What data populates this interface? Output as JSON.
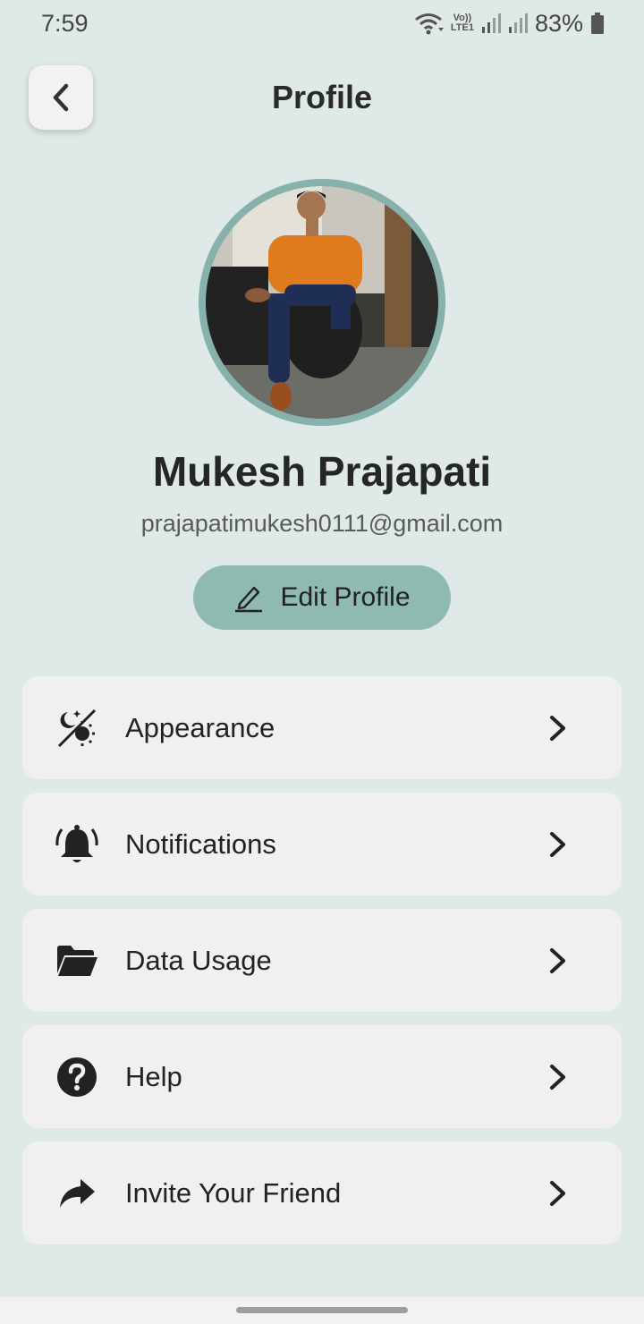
{
  "status_bar": {
    "time": "7:59",
    "volte_top": "Vo))",
    "volte_bottom": "LTE1",
    "battery": "83%"
  },
  "header": {
    "title": "Profile",
    "back_icon": "chevron-left-icon"
  },
  "profile": {
    "name": "Mukesh Prajapati",
    "email": "prajapatimukesh0111@gmail.com",
    "edit_label": "Edit Profile"
  },
  "menu": {
    "items": [
      {
        "label": "Appearance",
        "icon": "theme-icon"
      },
      {
        "label": "Notifications",
        "icon": "bell-icon"
      },
      {
        "label": "Data Usage",
        "icon": "folder-icon"
      },
      {
        "label": "Help",
        "icon": "help-icon"
      },
      {
        "label": "Invite Your Friend",
        "icon": "share-icon"
      }
    ]
  },
  "colors": {
    "background": "#dfeae8",
    "accent": "#8fbab2",
    "card": "#f0f0f0"
  }
}
